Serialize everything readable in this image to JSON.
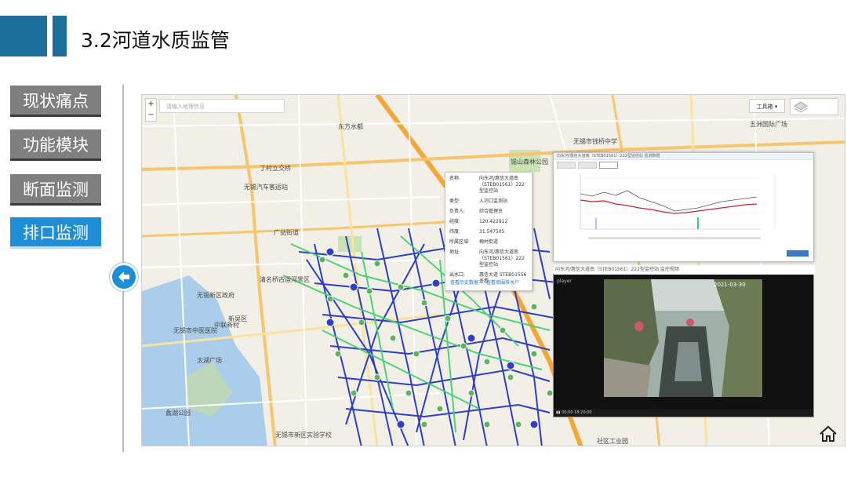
{
  "title": "3.2河道水质监管",
  "nav": {
    "items": [
      {
        "label": "现状痛点"
      },
      {
        "label": "功能模块"
      },
      {
        "label": "断面监测"
      },
      {
        "label": "排口监测"
      }
    ],
    "active_index": 3
  },
  "colors": {
    "accent": "#1e8fd6",
    "header_bar": "#1b6f9a",
    "nav_inactive": "#7f7f7f"
  },
  "map": {
    "search_placeholder": "请输入地理信息",
    "tools_label": "工具箱",
    "labels": [
      {
        "text": "无锡汽车客运站"
      },
      {
        "text": "广益街道"
      },
      {
        "text": "无锡新区政府"
      },
      {
        "text": "新吴区"
      },
      {
        "text": "无锡市中医医院"
      },
      {
        "text": "中联新村"
      },
      {
        "text": "五洲国际广场"
      },
      {
        "text": "无锡市钱桥中学"
      },
      {
        "text": "锡山森林公园"
      },
      {
        "text": "太湖广场"
      },
      {
        "text": "社区工业园"
      },
      {
        "text": "无锡市新区实验学校"
      },
      {
        "text": "蠡湖公园"
      },
      {
        "text": "清名桥古运河景区"
      },
      {
        "text": "东方水都"
      },
      {
        "text": "丁村立交桥"
      }
    ]
  },
  "popup": {
    "rows": [
      {
        "k": "名称:",
        "v": "向东河/惠信大道南（STEB01561）222型监控站"
      },
      {
        "k": "类型:",
        "v": "入河口监测站"
      },
      {
        "k": "负责人:",
        "v": "综合管理员"
      },
      {
        "k": "经度:",
        "v": "120.422912"
      },
      {
        "k": "纬度:",
        "v": "31.547505"
      },
      {
        "k": "所属区域:",
        "v": "梅村街道"
      },
      {
        "k": "地址:",
        "v": "向东河/惠信大道南（STEB01561）222型监控站"
      },
      {
        "k": "出水口:",
        "v": "惠信大道 STEB01556 查看"
      }
    ],
    "link_history": "查看历史数据",
    "link_upstream": "查看周围排水户"
  },
  "chart_window": {
    "title": "向东河/惠信大道南（STEB01561）222型监控站 监测数据"
  },
  "video_window": {
    "title": "向东河/惠信大道南（STEB01561）222型监控站 监控视频",
    "player_label": "player",
    "timestamp": "2021-03-30",
    "time_readout": "00:00 18:20:00"
  }
}
